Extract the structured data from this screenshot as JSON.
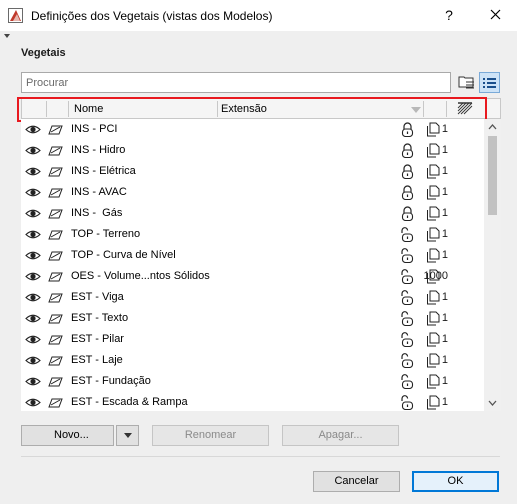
{
  "window": {
    "title": "Definições dos Vegetais (vistas dos Modelos)",
    "help_label": "?"
  },
  "section": {
    "label": "Vegetais"
  },
  "search": {
    "placeholder": "Procurar",
    "value": ""
  },
  "table": {
    "columns": [
      "Nome",
      "Extensão"
    ],
    "rows": [
      {
        "name": "INS - PCI",
        "lock": "locked",
        "count": "1"
      },
      {
        "name": "INS - Hidro",
        "lock": "locked",
        "count": "1"
      },
      {
        "name": "INS - Elétrica",
        "lock": "locked",
        "count": "1"
      },
      {
        "name": "INS - AVAC",
        "lock": "locked",
        "count": "1"
      },
      {
        "name": "INS -  Gás",
        "lock": "locked",
        "count": "1"
      },
      {
        "name": "TOP - Terreno",
        "lock": "unlocked",
        "count": "1"
      },
      {
        "name": "TOP - Curva de Nível",
        "lock": "unlocked",
        "count": "1"
      },
      {
        "name": "OES - Volume...ntos Sólidos",
        "lock": "unlocked",
        "count": "1000"
      },
      {
        "name": "EST - Viga",
        "lock": "unlocked",
        "count": "1"
      },
      {
        "name": "EST - Texto",
        "lock": "unlocked",
        "count": "1"
      },
      {
        "name": "EST - Pilar",
        "lock": "unlocked",
        "count": "1"
      },
      {
        "name": "EST - Laje",
        "lock": "unlocked",
        "count": "1"
      },
      {
        "name": "EST - Fundação",
        "lock": "unlocked",
        "count": "1"
      },
      {
        "name": "EST - Escada & Rampa",
        "lock": "unlocked",
        "count": "1"
      }
    ]
  },
  "buttons": {
    "new": "Novo...",
    "rename": "Renomear",
    "delete": "Apagar...",
    "cancel": "Cancelar",
    "ok": "OK"
  },
  "icons": {
    "visibility": "eye-icon",
    "edit": "pencil-icon",
    "lock": "lock-icon",
    "pages": "pages-icon",
    "folder_view": "folder-tree-icon",
    "list_view": "list-view-icon",
    "fill": "hatch-icon"
  },
  "colors": {
    "highlight": "#e8191f",
    "selected_view": "#cde3f7",
    "ok_border": "#0078d7"
  }
}
